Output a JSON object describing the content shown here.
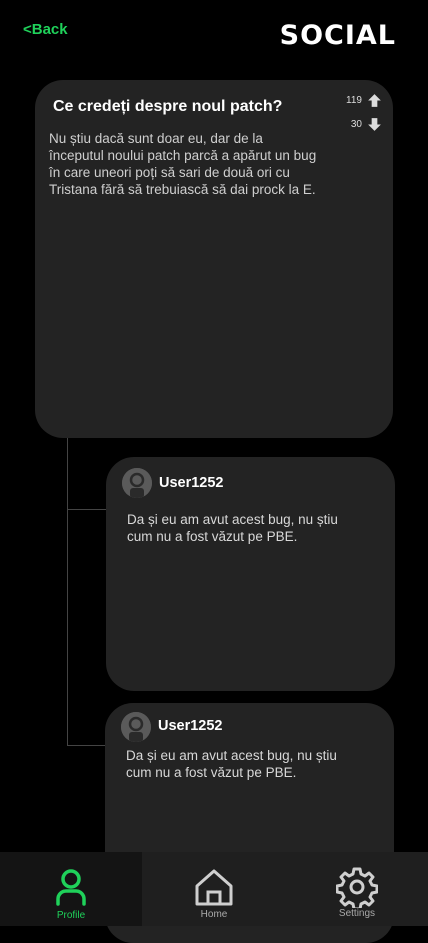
{
  "header": {
    "back_label": "<Back",
    "title": "SOCIAL"
  },
  "post": {
    "title": "Ce credeți despre noul patch?",
    "body": "Nu știu dacă sunt doar eu, dar de la începutul noului patch parcă a apărut un bug în care uneori poți să sari de două ori cu Tristana fără să trebuiască să dai prock la E.",
    "upvotes": "119",
    "downvotes": "30"
  },
  "replies": [
    {
      "user": "User1252",
      "text": "Da și eu am avut acest bug, nu știu cum nu a fost văzut pe PBE."
    },
    {
      "user": "User1252",
      "text": "Da și eu am avut acest bug, nu știu cum nu a fost văzut pe PBE."
    }
  ],
  "nav": {
    "items": [
      {
        "label": "Profile",
        "icon": "person-icon",
        "active": true
      },
      {
        "label": "Home",
        "icon": "home-icon",
        "active": false
      },
      {
        "label": "Settings",
        "icon": "gear-icon",
        "active": false
      }
    ]
  },
  "colors": {
    "accent": "#1fd15a",
    "card": "#232323",
    "background": "#000000"
  }
}
